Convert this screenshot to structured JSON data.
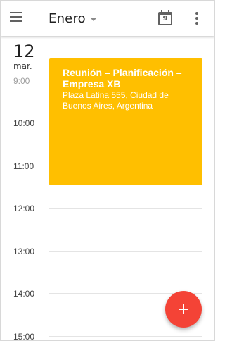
{
  "header": {
    "month": "Enero",
    "today_number": "9"
  },
  "day": {
    "number": "12",
    "weekday": "mar."
  },
  "timeline": {
    "labels": [
      "9:00",
      "10:00",
      "11:00",
      "12:00",
      "13:00",
      "14:00",
      "15:00"
    ]
  },
  "event": {
    "title": "Reunión – Planificación – Empresa XB",
    "location": "Plaza Latina 555, Ciudad de Buenos Aires, Argentina",
    "color": "#ffbf00"
  },
  "fab": {
    "icon": "plus-icon",
    "color": "#f44336"
  }
}
